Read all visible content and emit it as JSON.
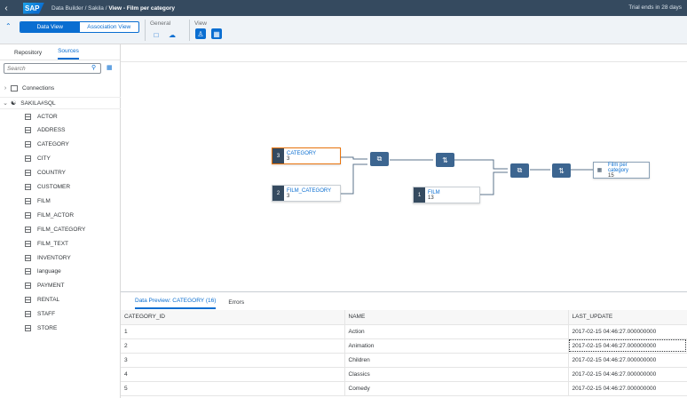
{
  "shell": {
    "breadcrumb": "Data Builder / Sakila / ",
    "view_title": "View - Film per category",
    "trial": "Trial ends in 28 days",
    "logo": "SAP"
  },
  "toolbar": {
    "data_view": "Data View",
    "association_view": "Association View",
    "general": "General",
    "view": "View"
  },
  "left": {
    "tabs": [
      "Repository",
      "Sources"
    ],
    "search_placeholder": "Search",
    "connections": "Connections",
    "schema": "SAKILA#SQL",
    "tables": [
      "ACTOR",
      "ADDRESS",
      "CATEGORY",
      "CITY",
      "COUNTRY",
      "CUSTOMER",
      "FILM",
      "FILM_ACTOR",
      "FILM_CATEGORY",
      "FILM_TEXT",
      "INVENTORY",
      "language",
      "PAYMENT",
      "RENTAL",
      "STAFF",
      "STORE"
    ]
  },
  "canvas": {
    "nodes": [
      {
        "badge": "3",
        "name": "CATEGORY",
        "cols": "3"
      },
      {
        "badge": "2",
        "name": "FILM_CATEGORY",
        "cols": "3"
      },
      {
        "badge": "1",
        "name": "FILM",
        "cols": "13"
      },
      {
        "name": "Film per category",
        "cols": "15"
      }
    ]
  },
  "bottom": {
    "tabs": [
      "Data Preview: CATEGORY (16)",
      "Errors"
    ],
    "columns": [
      "CATEGORY_ID",
      "NAME",
      "LAST_UPDATE"
    ],
    "rows": [
      [
        "1",
        "Action",
        "2017-02-15 04:46:27.000000000"
      ],
      [
        "2",
        "Animation",
        "2017-02-15 04:46:27.000000000"
      ],
      [
        "3",
        "Children",
        "2017-02-15 04:46:27.000000000"
      ],
      [
        "4",
        "Classics",
        "2017-02-15 04:46:27.000000000"
      ],
      [
        "5",
        "Comedy",
        "2017-02-15 04:46:27.000000000"
      ]
    ]
  },
  "colors": {
    "shell": "#354a5f",
    "accent": "#0a6ed1",
    "operator": "#3c6590",
    "selected": "#e9730c"
  }
}
